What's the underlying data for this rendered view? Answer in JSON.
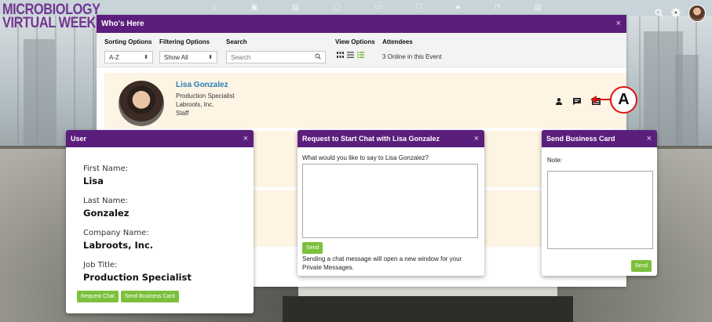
{
  "app": {
    "logo_line1": "MICROBIOLOGY",
    "logo_line2": "VIRTUAL WEEK",
    "nav_icons": [
      "home-icon",
      "info-icon",
      "stats-icon",
      "booth-icon",
      "video-icon",
      "cart-icon",
      "globe-icon",
      "briefcase-icon",
      "chat-icon"
    ],
    "top_right_icons": [
      "search-icon",
      "gear-icon",
      "user-avatar"
    ]
  },
  "whos_here": {
    "title": "Who's Here",
    "close": "×",
    "sorting_label": "Sorting Options",
    "sorting_value": "A-Z",
    "filtering_label": "Filtering Options",
    "filtering_value": "Show All",
    "search_label": "Search",
    "search_placeholder": "Search",
    "view_label": "View Options",
    "attendees_label": "Attendees",
    "attendees_count": "3 Online in this Event",
    "person": {
      "name": "Lisa Gonzalez",
      "title": "Production Specialist",
      "company": "Labroots, Inc.",
      "role": "Staff"
    },
    "row_actions": [
      "user-icon",
      "chat-bubble-icon",
      "business-card-icon"
    ]
  },
  "callout": {
    "label": "A"
  },
  "user_modal": {
    "title": "User",
    "close": "×",
    "first_name_label": "First Name:",
    "first_name": "Lisa",
    "last_name_label": "Last Name:",
    "last_name": "Gonzalez",
    "company_label": "Company Name:",
    "company": "Labroots, Inc.",
    "job_label": "Job Title:",
    "job": "Production Specialist",
    "request_chat_button": "Request Chat",
    "send_card_button": "Send Business Card"
  },
  "chat_modal": {
    "title": "Request to Start Chat with Lisa Gonzalez",
    "close": "×",
    "prompt": "What would you like to say to Lisa Gonzalez?",
    "send_button": "Send",
    "note": "Sending a chat message will open a new window for your Private Messages."
  },
  "card_modal": {
    "title": "Send Business Card",
    "close": "×",
    "note_label": "Note:",
    "send_button": "Send"
  },
  "colors": {
    "header_purple": "#5b1e7c",
    "button_green": "#7cc03d",
    "name_blue": "#2a7fb5",
    "row_bg": "#fdf4e4",
    "callout_red": "#dd1111"
  }
}
